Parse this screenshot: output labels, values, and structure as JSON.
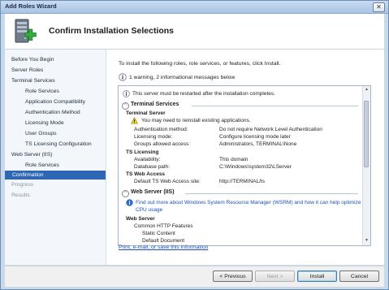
{
  "window": {
    "title": "Add Roles Wizard",
    "close_glyph": "✕"
  },
  "header": {
    "title": "Confirm Installation Selections",
    "icon": "server-role-add-icon"
  },
  "nav": {
    "items": [
      {
        "label": "Before You Begin",
        "state": "normal"
      },
      {
        "label": "Server Roles",
        "state": "normal"
      },
      {
        "label": "Terminal Services",
        "state": "normal"
      },
      {
        "label": "Role Services",
        "state": "normal"
      },
      {
        "label": "Application Compatibility",
        "state": "normal"
      },
      {
        "label": "Authentication Method",
        "state": "normal"
      },
      {
        "label": "Licensing Mode",
        "state": "normal"
      },
      {
        "label": "User Groups",
        "state": "normal"
      },
      {
        "label": "TS Licensing Configuration",
        "state": "normal"
      },
      {
        "label": "Web Server (IIS)",
        "state": "normal"
      },
      {
        "label": "Role Services",
        "state": "normal"
      },
      {
        "label": "Confirmation",
        "state": "selected"
      },
      {
        "label": "Progress",
        "state": "disabled"
      },
      {
        "label": "Results",
        "state": "disabled"
      }
    ]
  },
  "content": {
    "intro": "To install the following roles, role services, or features, click Install.",
    "warning_summary": "1 warning, 2 informational messages below",
    "restart_notice": "This server must be restarted after the installation completes.",
    "sections": {
      "terminal_services": {
        "title": "Terminal Services",
        "sub_title": "Terminal Server",
        "reinstall_warning": "You may need to reinstall existing applications.",
        "rows": [
          {
            "label": "Authentication method:",
            "value": "Do not require Network Level Authentication"
          },
          {
            "label": "Licensing mode:",
            "value": "Configure licensing mode later"
          },
          {
            "label": "Groups allowed access:",
            "value": "Administrators, TERMINAL\\None"
          }
        ],
        "ts_licensing": {
          "title": "TS Licensing",
          "rows": [
            {
              "label": "Availability:",
              "value": "This domain"
            },
            {
              "label": "Database path:",
              "value": "C:\\Windows\\system32\\LServer"
            }
          ]
        },
        "ts_web_access": {
          "title": "TS Web Access",
          "rows": [
            {
              "label": "Default TS Web Access site:",
              "value": "http://TERMINAL/ts"
            }
          ]
        }
      },
      "web_server": {
        "title": "Web Server (IIS)",
        "info_link_line1": "Find out more about Windows System Resource Manager (WSRM) and how it can help optimize",
        "info_link_line2": "CPU usage",
        "sub_title": "Web Server",
        "items": [
          "Common HTTP Features",
          "Static Content",
          "Default Document"
        ]
      }
    },
    "print_link": "Print, e-mail, or save this information"
  },
  "footer": {
    "previous": "< Previous",
    "next": "Next >",
    "install": "Install",
    "cancel": "Cancel"
  }
}
